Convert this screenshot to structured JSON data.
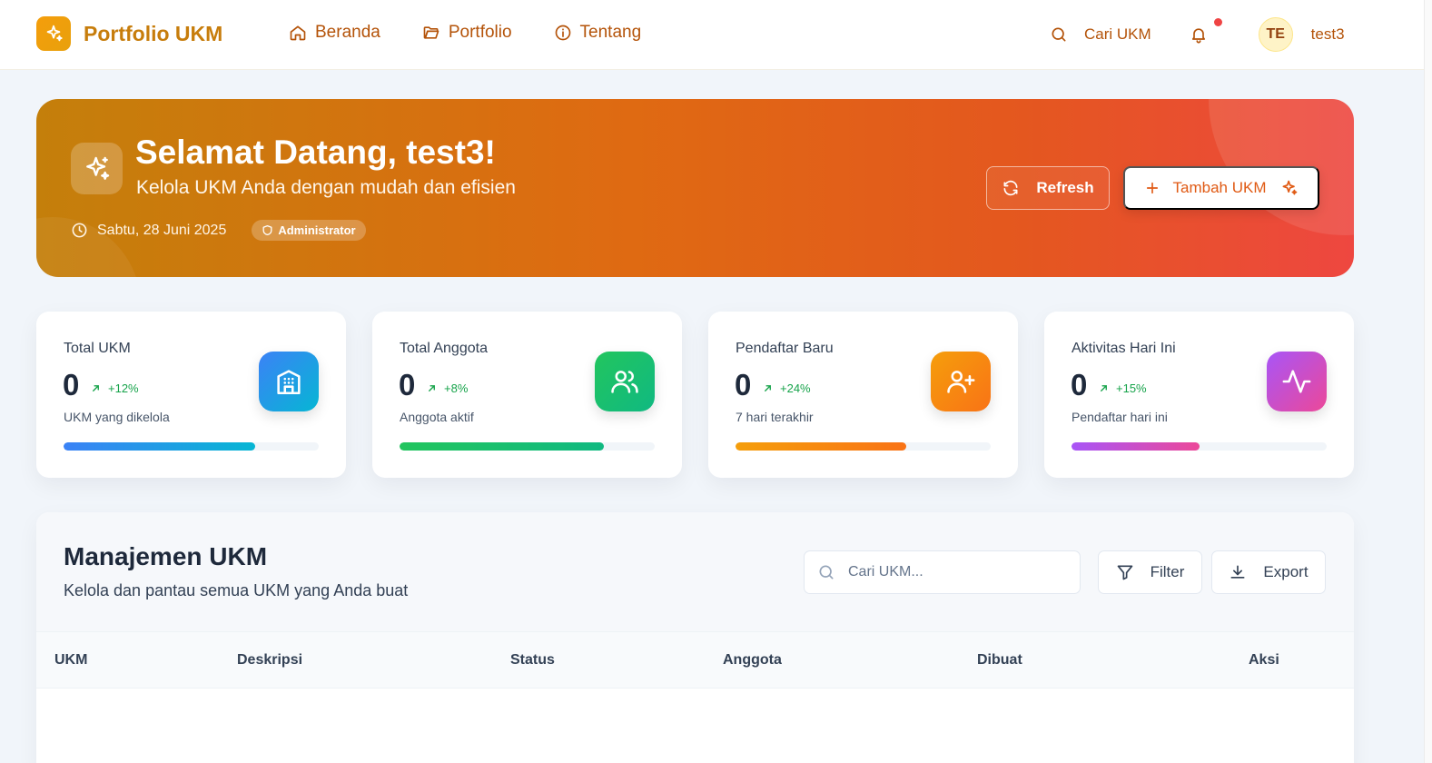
{
  "brand": {
    "name": "Portfolio UKM"
  },
  "nav": {
    "links": [
      {
        "label": "Beranda",
        "icon": "home-icon"
      },
      {
        "label": "Portfolio",
        "icon": "folder-icon"
      },
      {
        "label": "Tentang",
        "icon": "info-icon"
      }
    ],
    "search_label": "Cari UKM",
    "notification_dot_color": "#ef4444",
    "avatar_initials": "TE",
    "username": "test3"
  },
  "hero": {
    "title": "Selamat Datang, test3!",
    "subtitle": "Kelola UKM Anda dengan mudah dan efisien",
    "date": "Sabtu, 28 Juni 2025",
    "role": "Administrator",
    "refresh_label": "Refresh",
    "add_label": "Tambah UKM"
  },
  "stats": [
    {
      "label": "Total UKM",
      "value": "0",
      "change": "+12%",
      "desc": "UKM yang dikelola",
      "progress": 0.75,
      "icon": "building-icon",
      "colors": [
        "#3b82f6",
        "#06b6d4"
      ]
    },
    {
      "label": "Total Anggota",
      "value": "0",
      "change": "+8%",
      "desc": "Anggota aktif",
      "progress": 0.8,
      "icon": "users-icon",
      "colors": [
        "#22c55e",
        "#10b981"
      ]
    },
    {
      "label": "Pendaftar Baru",
      "value": "0",
      "change": "+24%",
      "desc": "7 hari terakhir",
      "progress": 0.67,
      "icon": "user-plus-icon",
      "colors": [
        "#f59e0b",
        "#f97316"
      ]
    },
    {
      "label": "Aktivitas Hari Ini",
      "value": "0",
      "change": "+15%",
      "desc": "Pendaftar hari ini",
      "progress": 0.5,
      "icon": "activity-icon",
      "colors": [
        "#a855f7",
        "#ec4899"
      ]
    }
  ],
  "management": {
    "title": "Manajemen UKM",
    "subtitle": "Kelola dan pantau semua UKM yang Anda buat",
    "search_placeholder": "Cari UKM...",
    "filter_label": "Filter",
    "export_label": "Export",
    "columns": [
      "UKM",
      "Deskripsi",
      "Status",
      "Anggota",
      "Dibuat",
      "Aksi"
    ],
    "rows": []
  }
}
